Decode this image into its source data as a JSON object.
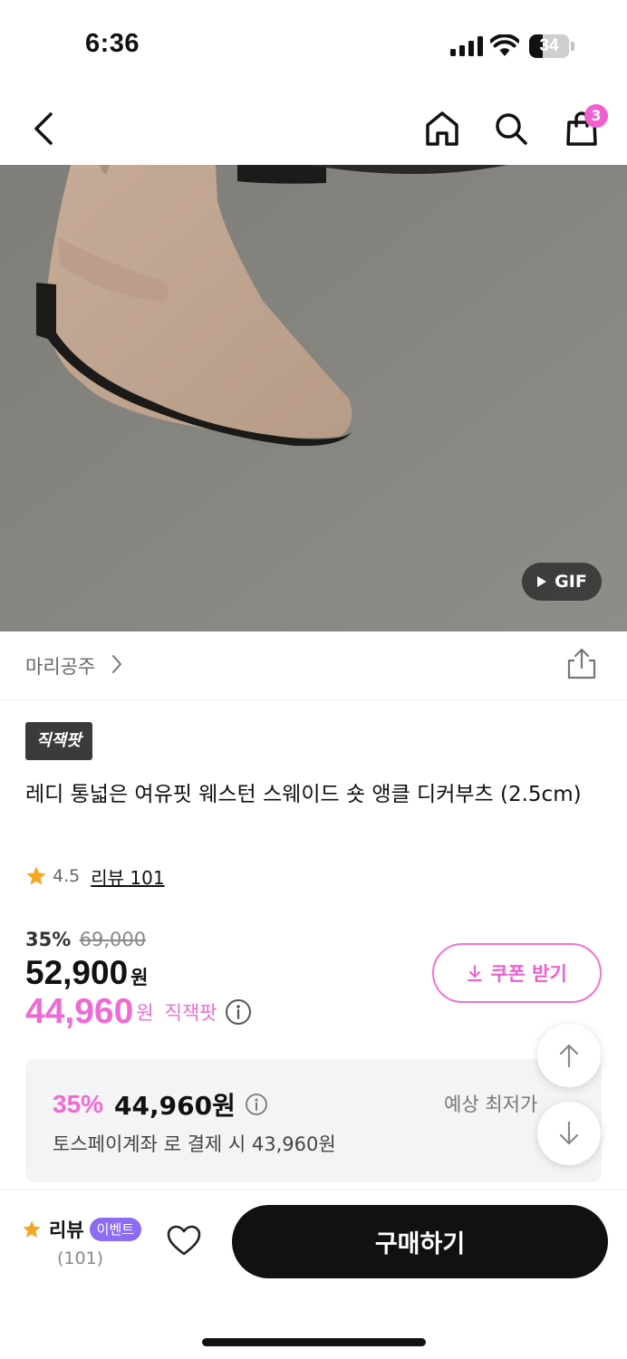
{
  "status_bar": {
    "time": "6:36",
    "battery": "34"
  },
  "nav": {
    "cart_count": "3"
  },
  "media": {
    "badge": "GIF"
  },
  "shop": {
    "name": "마리공주"
  },
  "product": {
    "tag": "직잭팟",
    "title": "레디 통넓은 여유핏 웨스턴 스웨이드 숏 앵클 디커부츠 (2.5cm)",
    "rating": "4.5",
    "review_link": "리뷰 101"
  },
  "price": {
    "discount": "35%",
    "original": "69,000",
    "sale": "52,900",
    "currency": "원",
    "member_price": "44,960",
    "member_label": "직잭팟",
    "coupon_label": "쿠폰 받기"
  },
  "lowest": {
    "percent": "35%",
    "price": "44,960원",
    "label": "예상 최저가",
    "note": "토스페이계좌 로 결제 시 43,960원"
  },
  "bottom_bar": {
    "review_label": "리뷰",
    "event_badge": "이벤트",
    "review_count": "(101)",
    "buy_label": "구매하기"
  },
  "colors": {
    "accent_pink": "#f06ad4",
    "event_purple": "#8c6cf2",
    "buy_button": "#111111"
  }
}
